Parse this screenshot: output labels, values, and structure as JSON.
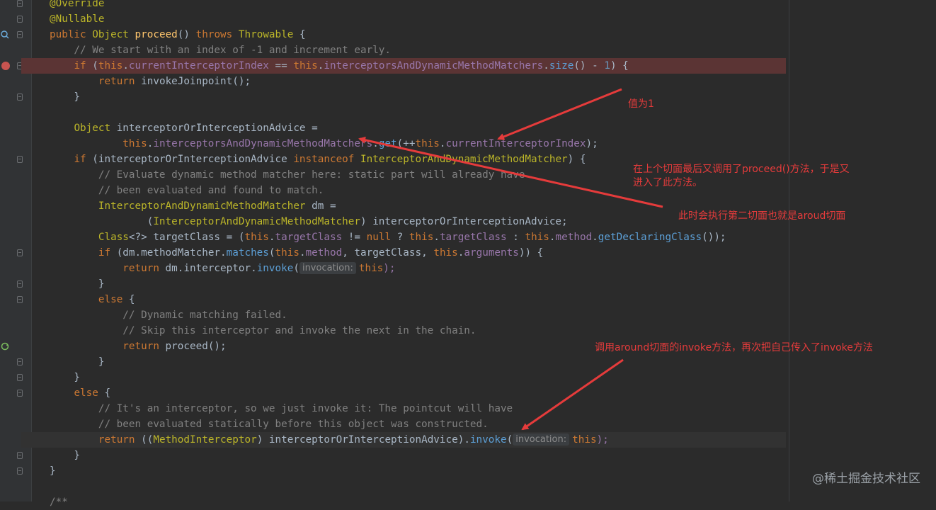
{
  "editor": {
    "lines": [
      [
        "@Override"
      ],
      [
        "@Nullable"
      ],
      [
        "public Object proceed() throws Throwable {"
      ],
      [
        "    // We start with an index of -1 and increment early."
      ],
      [
        "    if (this.currentInterceptorIndex == this.interceptorsAndDynamicMethodMatchers.size() - 1) {"
      ],
      [
        "        return invokeJoinpoint();"
      ],
      [
        "    }"
      ],
      [
        ""
      ],
      [
        "    Object interceptorOrInterceptionAdvice ="
      ],
      [
        "            this.interceptorsAndDynamicMethodMatchers.get(++this.currentInterceptorIndex);"
      ],
      [
        "    if (interceptorOrInterceptionAdvice instanceof InterceptorAndDynamicMethodMatcher) {"
      ],
      [
        "        // Evaluate dynamic method matcher here: static part will already have"
      ],
      [
        "        // been evaluated and found to match."
      ],
      [
        "        InterceptorAndDynamicMethodMatcher dm ="
      ],
      [
        "                (InterceptorAndDynamicMethodMatcher) interceptorOrInterceptionAdvice;"
      ],
      [
        "        Class<?> targetClass = (this.targetClass != null ? this.targetClass : this.method.getDeclaringClass());"
      ],
      [
        "        if (dm.methodMatcher.matches(this.method, targetClass, this.arguments)) {"
      ],
      [
        "            return dm.interceptor.invoke(",
        "invocation:",
        "this);"
      ],
      [
        "        }"
      ],
      [
        "        else {"
      ],
      [
        "            // Dynamic matching failed."
      ],
      [
        "            // Skip this interceptor and invoke the next in the chain."
      ],
      [
        "            return proceed();"
      ],
      [
        "        }"
      ],
      [
        "    }"
      ],
      [
        "    else {"
      ],
      [
        "        // It's an interceptor, so we just invoke it: The pointcut will have"
      ],
      [
        "        // been evaluated statically before this object was constructed."
      ],
      [
        "        return ((MethodInterceptor) interceptorOrInterceptionAdvice).invoke(",
        "invocation:",
        "this);"
      ],
      [
        "    }"
      ],
      [
        "}"
      ],
      [
        ""
      ],
      [
        "/**"
      ]
    ]
  },
  "annotations": {
    "value_is_one": "值为1",
    "proceed_again": "在上个切面最后又调用了proceed()方法，于是又",
    "proceed_again_2": "进入了此方法。",
    "second_aspect": "此时会执行第二切面也就是aroud切面",
    "invoke_around": "调用around切面的invoke方法，再次把自己传入了invoke方法"
  },
  "watermark": "@稀土掘金技术社区",
  "colors": {
    "background": "#2b2b2b",
    "highlight_line": "#5b3434",
    "annotation_red": "#e53b3b"
  }
}
